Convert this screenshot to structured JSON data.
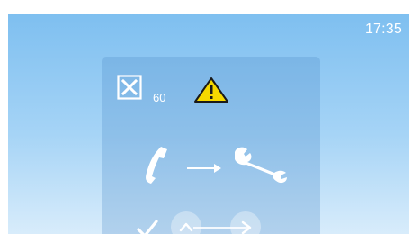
{
  "status_bar": {
    "time": "17:35"
  },
  "dialog": {
    "timeout_value": "60",
    "icons": {
      "close": "close-box-icon",
      "warning": "warning-triangle-icon",
      "phone": "phone-handset-icon",
      "arrow": "arrow-right-icon",
      "service": "wrench-icon",
      "confirm": "checkmark-icon",
      "up": "chevron-up-icon",
      "next": "chevron-right-icon"
    },
    "colors": {
      "warning_fill": "#f5d800",
      "foreground": "#ffffff"
    }
  }
}
